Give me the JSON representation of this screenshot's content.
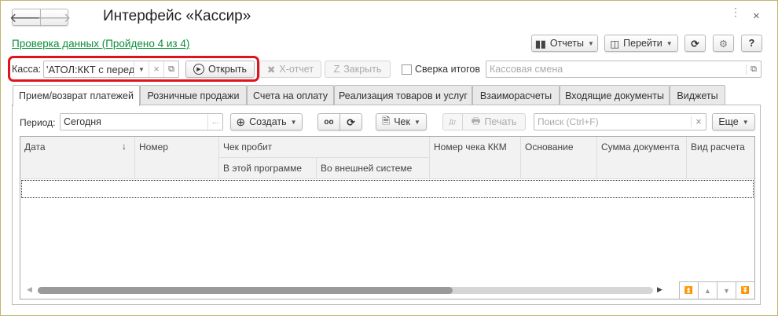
{
  "window": {
    "title": "Интерфейс «Кассир»",
    "border_color": "#c4b46a"
  },
  "data_check_link": "Проверка данных (Пройдено 4 из 4)",
  "toolbar_right": {
    "reports": "Отчеты",
    "goto": "Перейти",
    "help": "?"
  },
  "kassa": {
    "label": "Касса:",
    "value": "'АТОЛ:ККТ с передачей",
    "open": "Открыть",
    "x_report": "X-отчет",
    "close": "Закрыть",
    "reconcile": "Сверка итогов",
    "reconcile_checked": false,
    "shift_placeholder": "Кассовая смена",
    "highlight_color": "#e0141e"
  },
  "tabs": [
    {
      "label": "Прием/возврат платежей",
      "active": true
    },
    {
      "label": "Розничные продажи"
    },
    {
      "label": "Счета на оплату"
    },
    {
      "label": "Реализация товаров и услуг"
    },
    {
      "label": "Взаиморасчеты"
    },
    {
      "label": "Входящие документы"
    },
    {
      "label": "Виджеты"
    }
  ],
  "list_toolbar": {
    "period_label": "Период:",
    "period_value": "Сегодня",
    "period_more": "...",
    "create": "Создать",
    "check": "Чек",
    "print": "Печать",
    "search_placeholder": "Поиск (Ctrl+F)",
    "more": "Еще"
  },
  "table": {
    "columns": {
      "date": "Дата",
      "number": "Номер",
      "check_printed": "Чек пробит",
      "in_program": "В этой программе",
      "external": "Во внешней системе",
      "kkm_number": "Номер чека ККМ",
      "basis": "Основание",
      "amount": "Сумма документа",
      "payment_type": "Вид расчета"
    },
    "rows": []
  },
  "link_color": "#0b8f3a"
}
